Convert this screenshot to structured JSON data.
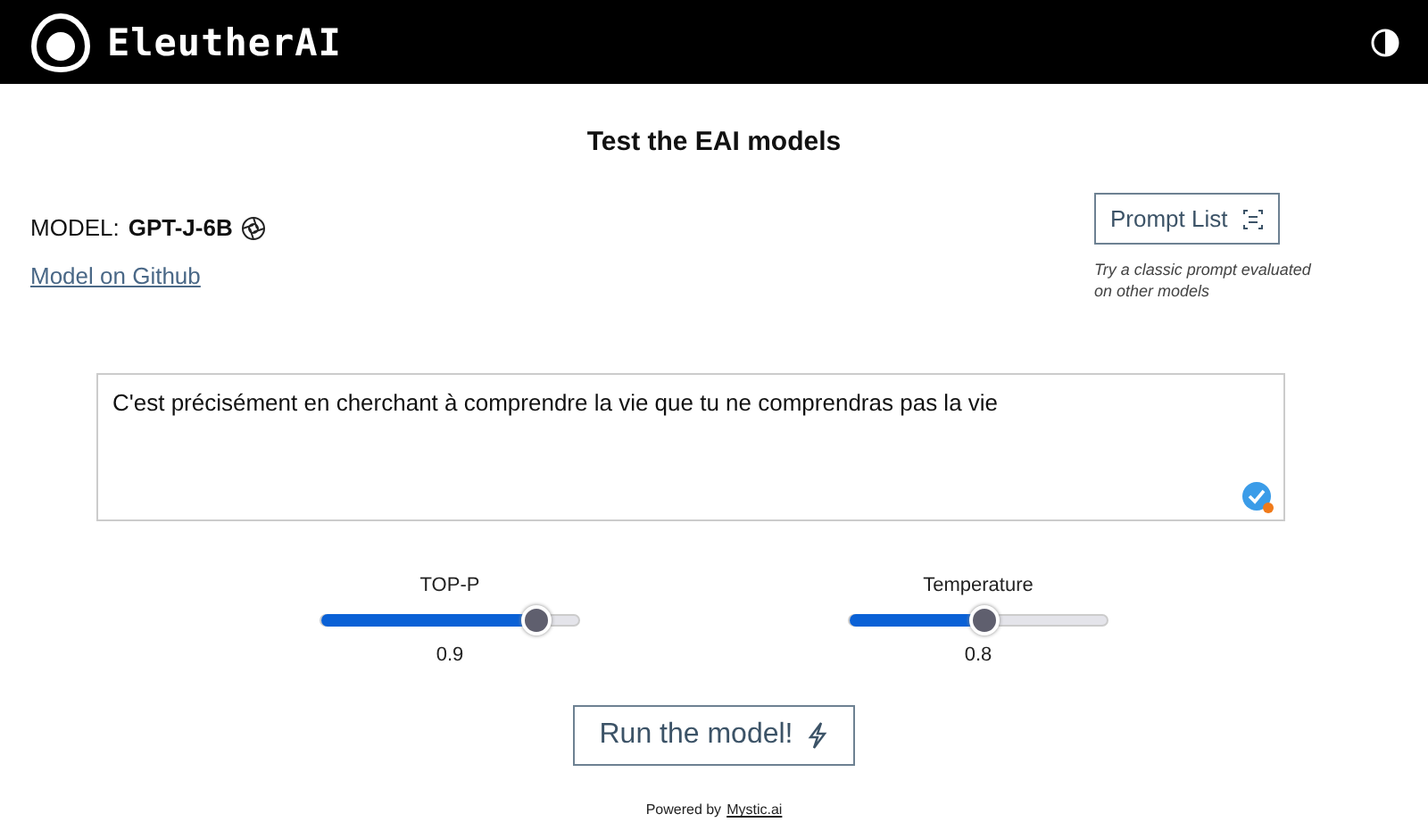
{
  "header": {
    "brand": "EleutherAI"
  },
  "title": "Test the EAI models",
  "model": {
    "label": "MODEL:",
    "name": "GPT-J-6B",
    "link": "Model on Github"
  },
  "prompt_list": {
    "button": "Prompt List",
    "hint": "Try a classic prompt evaluated on other models"
  },
  "prompt": {
    "value": "C'est précisément en cherchant à comprendre la vie que tu ne comprendras pas la vie"
  },
  "sliders": [
    {
      "label": "TOP-P",
      "level": 0.84,
      "reading": "0.9"
    },
    {
      "label": "Temperature",
      "level": 0.53,
      "reading": "0.8"
    }
  ],
  "run_button": "Run the model!",
  "footer": {
    "text": "Powered by",
    "link": "Mystic.ai"
  }
}
